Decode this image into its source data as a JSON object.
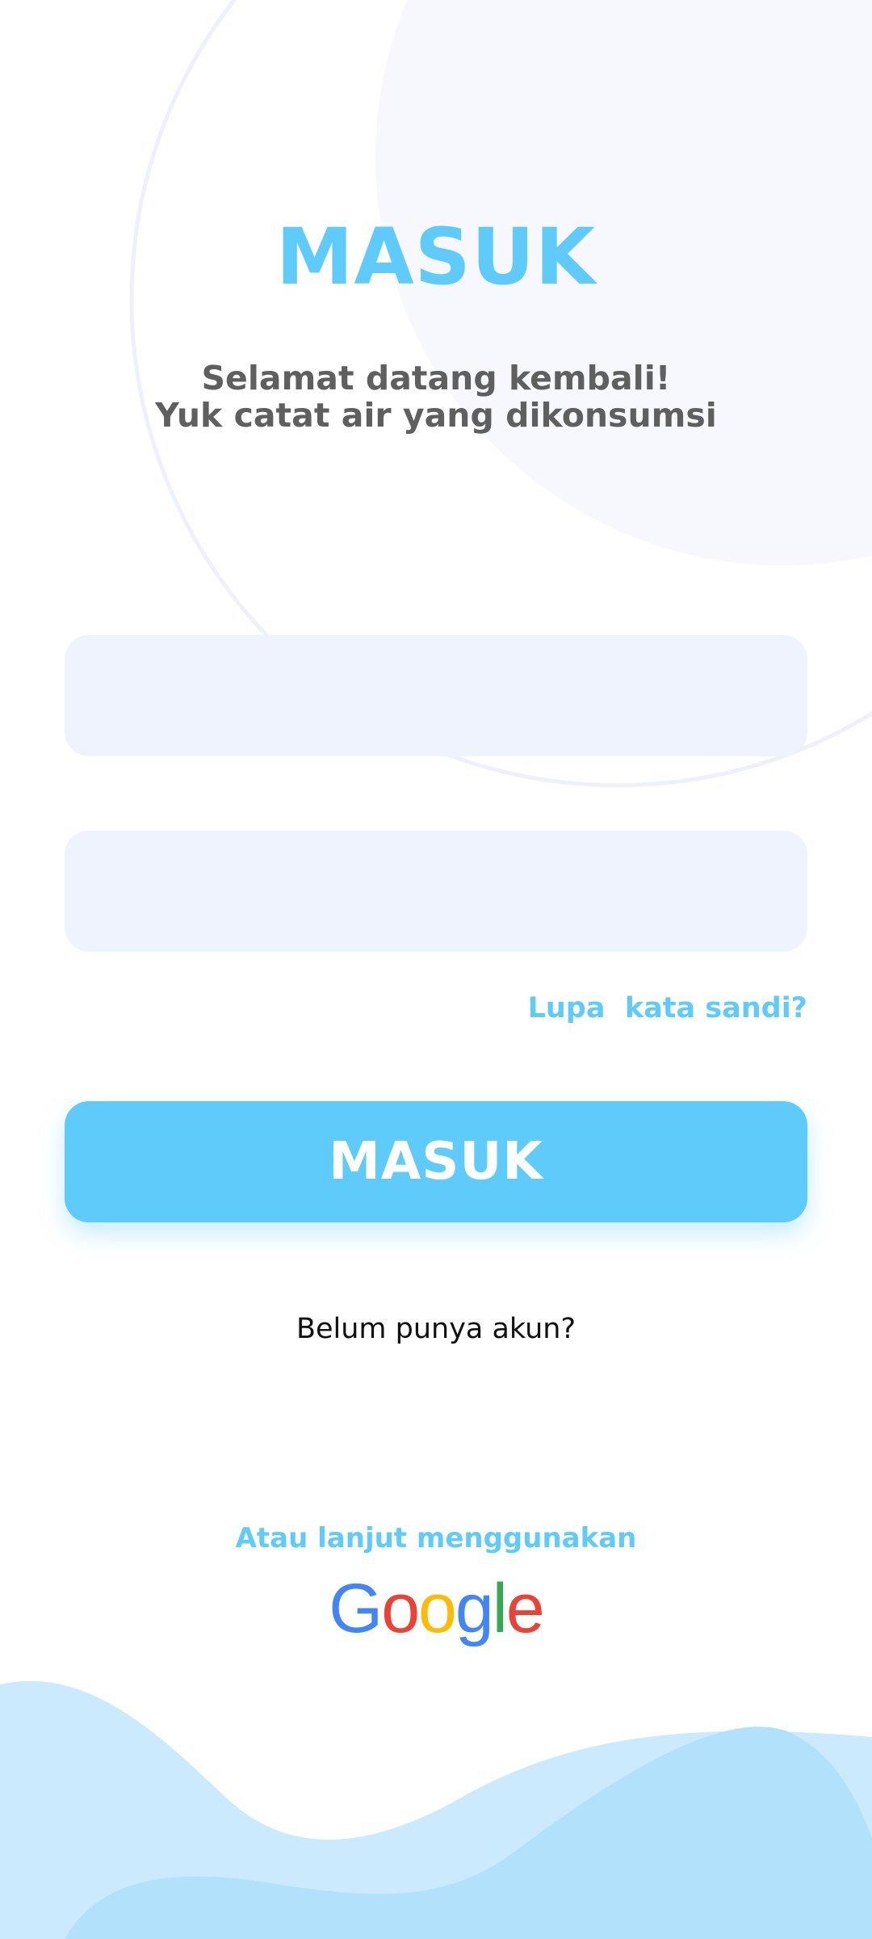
{
  "page": {
    "title": "MASUK",
    "subtitle_line1": "Selamat datang kembali!",
    "subtitle_line2": "Yuk catat air yang dikonsumsi"
  },
  "form": {
    "email_placeholder": "",
    "password_placeholder": "",
    "forgot_label": "Lupa  kata sandi?",
    "submit_label": "MASUK"
  },
  "register": {
    "label": "Belum punya akun?"
  },
  "alternative": {
    "label": "Atau lanjut menggunakan",
    "google_letters": [
      "G",
      "o",
      "o",
      "g",
      "l",
      "e"
    ],
    "google_colors": [
      "#4285F4",
      "#EA4335",
      "#FBBC05",
      "#4285F4",
      "#34A853",
      "#EA4335"
    ]
  },
  "colors": {
    "accent": "#5ecbfa",
    "input_bg": "#eff3fe",
    "text_gray": "#5f5f5f"
  }
}
